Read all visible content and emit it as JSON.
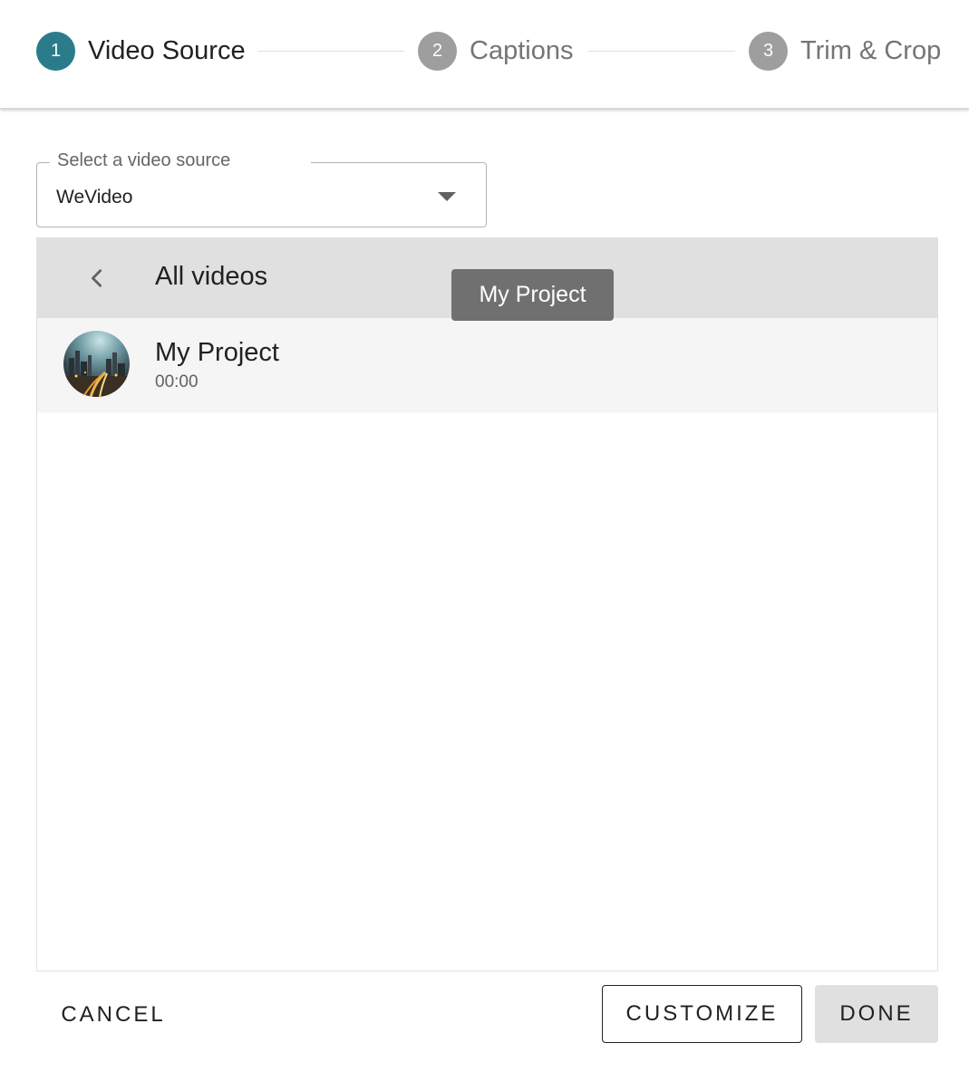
{
  "stepper": {
    "steps": [
      {
        "number": "1",
        "label": "Video Source",
        "state": "active"
      },
      {
        "number": "2",
        "label": "Captions",
        "state": "inactive"
      },
      {
        "number": "3",
        "label": "Trim & Crop",
        "state": "inactive"
      }
    ],
    "colors": {
      "active": "#2a7c8a",
      "inactive": "#9e9e9e"
    }
  },
  "source_select": {
    "label": "Select a video source",
    "value": "WeVideo",
    "icon": "dropdown-arrow-icon"
  },
  "panel": {
    "back_icon": "chevron-left-icon",
    "title": "All videos",
    "items": [
      {
        "title": "My Project",
        "duration": "00:00",
        "thumbnail": "city-night-thumbnail"
      }
    ]
  },
  "tooltip": {
    "text": "My Project"
  },
  "footer": {
    "cancel_label": "CANCEL",
    "customize_label": "CUSTOMIZE",
    "done_label": "DONE"
  }
}
